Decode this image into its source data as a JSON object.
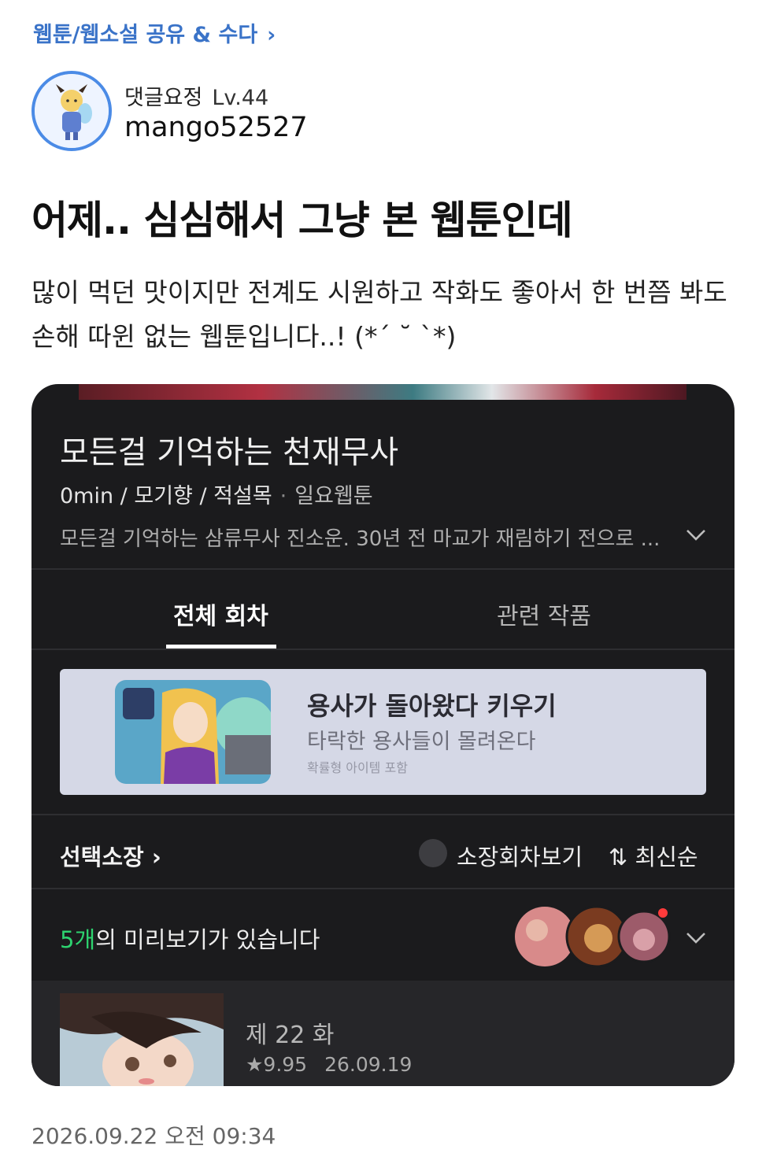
{
  "board": {
    "label": "웹툰/웹소설 공유 & 수다",
    "chevron": "›"
  },
  "author": {
    "nickname": "댓글요정",
    "level": "Lv.44",
    "id": "mango52527"
  },
  "post": {
    "title": "어제.. 심심해서 그냥 본 웹툰인데",
    "body": "많이 먹던 맛이지만 전계도 시원하고 작화도 좋아서 한 번쯤 봐도\n손해 따윈 없는 웹툰입니다..! (*´ ˘ `*)",
    "timestamp": "2026.09.22 오전 09:34"
  },
  "webtoon": {
    "title": "모든걸 기억하는 천재무사",
    "creators": "0min / 모기향 / 적설목",
    "separator": "·",
    "day": "일요웹툰",
    "description": "모든걸 기억하는 삼류무사 진소운. 30년 전 마교가 재림하기 전으로 ..."
  },
  "tabs": [
    {
      "label": "전체 회차",
      "active": true
    },
    {
      "label": "관련 작품",
      "active": false
    }
  ],
  "ad": {
    "title": "용사가 돌아왔다 키우기",
    "subtitle": "타락한 용사들이 몰려온다",
    "note": "확률형 아이템 포함"
  },
  "controls": {
    "select_buy": "선택소장 ›",
    "owned_view": "소장회차보기",
    "sort": "⇅ 최신순"
  },
  "preview": {
    "count": "5개",
    "text": "의 미리보기가 있습니다"
  },
  "episode": {
    "title": "제 22 화",
    "rating": "★9.95",
    "date": "26.09.19"
  },
  "colors": {
    "board_link": "#3a73c8",
    "avatar_ring": "#4b8be6",
    "preview_count": "#2dd36f",
    "app_bg": "#1b1b1d",
    "notification_dot": "#ff3b3b"
  }
}
